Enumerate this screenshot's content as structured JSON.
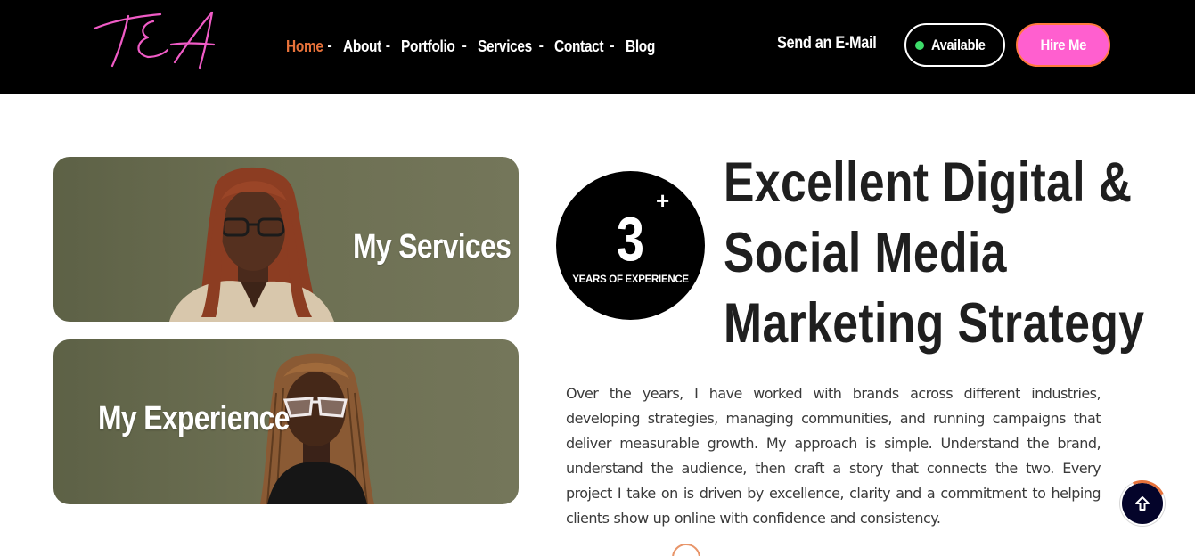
{
  "header": {
    "logo_text": "TEA",
    "nav": [
      {
        "label": "Home",
        "active": true
      },
      {
        "label": "About",
        "active": false
      },
      {
        "label": "Portfolio",
        "active": false
      },
      {
        "label": "Services",
        "active": false
      },
      {
        "label": "Contact",
        "active": false
      },
      {
        "label": "Blog",
        "active": false
      }
    ],
    "nav_separator": "-",
    "send_email_label": "Send an E-Mail",
    "available_label": "Available",
    "hire_label": "Hire Me"
  },
  "cards": {
    "services_title": "My Services",
    "experience_title": "My Experience"
  },
  "badge": {
    "number": "3",
    "plus": "+",
    "label": "YEARS OF EXPERIENCE"
  },
  "headline": {
    "line1": "Excellent Digital &",
    "line2": "Social Media",
    "line3": "Marketing Strategy"
  },
  "body_text": "Over the years, I have worked with brands across different industries, developing strategies, managing communities, and running campaigns that deliver measurable growth. My approach is simple. Understand the brand, understand the audience, then craft a story that connects the two. Every project I take on is driven by excellence, clarity and a commitment to helping clients show up online with confidence and consistency.",
  "colors": {
    "header_bg": "#000000",
    "active_nav": "#e8723a",
    "hire_bg": "#ff5fcf",
    "available_dot": "#3ddc6a",
    "card_bg": "#6c6f52",
    "scroll_top_bg": "#04042a"
  },
  "icons": {
    "scroll_top": "arrow-up-icon",
    "available": "status-dot-icon"
  }
}
